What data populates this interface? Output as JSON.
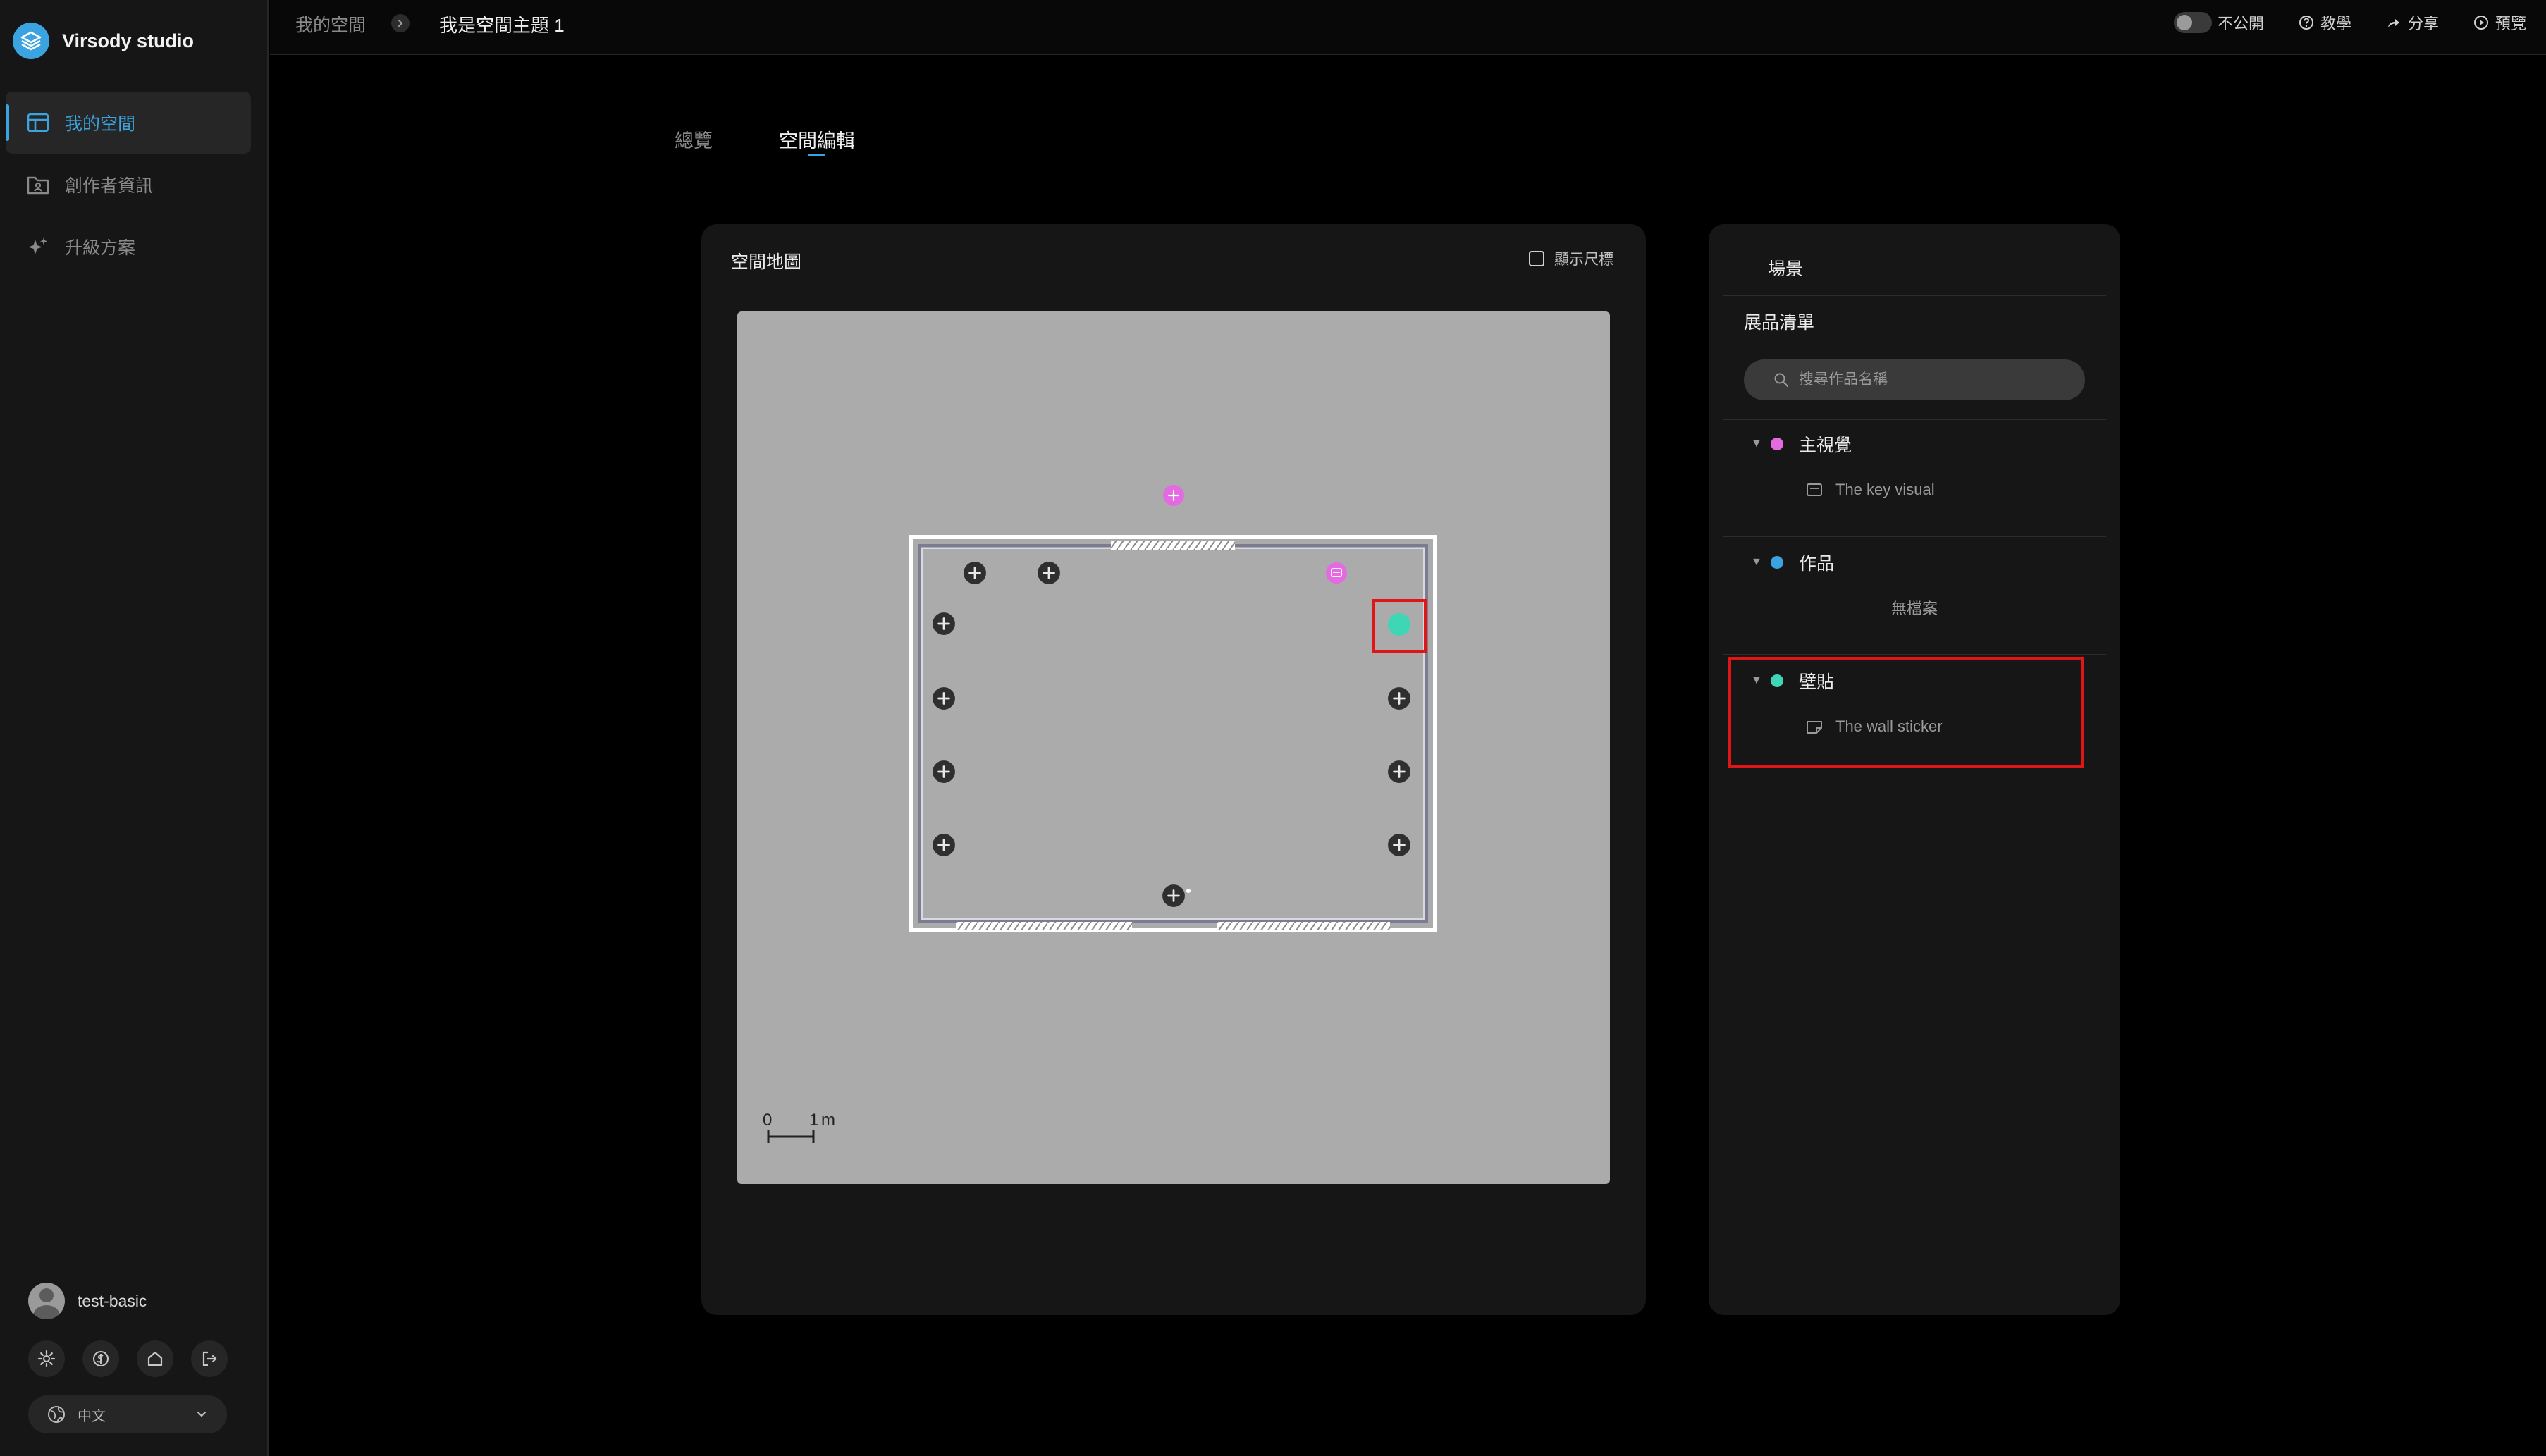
{
  "app": {
    "name": "Virsody studio"
  },
  "sidebar": {
    "items": [
      {
        "label": "我的空間",
        "icon": "layout-icon",
        "active": true
      },
      {
        "label": "創作者資訊",
        "icon": "folder-user-icon",
        "active": false
      },
      {
        "label": "升級方案",
        "icon": "sparkle-icon",
        "active": false
      }
    ],
    "user": {
      "name": "test-basic"
    },
    "tools": [
      "settings-icon",
      "dollar-icon",
      "home-icon",
      "logout-icon"
    ],
    "language": {
      "selected": "中文"
    }
  },
  "breadcrumb": {
    "root": "我的空間",
    "current": "我是空間主題 1"
  },
  "topbar": {
    "visibility_label": "不公開",
    "tutorial_label": "教學",
    "share_label": "分享",
    "preview_label": "預覽"
  },
  "tabs": [
    {
      "label": "總覽",
      "active": false
    },
    {
      "label": "空間編輯",
      "active": true
    }
  ],
  "map_panel": {
    "title": "空間地圖",
    "show_ruler_label": "顯示尺標",
    "show_ruler_checked": false,
    "scale_zero": "0",
    "scale_one": "1",
    "scale_unit": "m"
  },
  "scene_panel": {
    "tab_label": "場景",
    "list_title": "展品清單",
    "search_placeholder": "搜尋作品名稱",
    "groups": [
      {
        "label": "主視覺",
        "color": "#e36ae0",
        "items": [
          "The key visual"
        ],
        "empty_label": ""
      },
      {
        "label": "作品",
        "color": "#3aa3e0",
        "items": [],
        "empty_label": "無檔案"
      },
      {
        "label": "壁貼",
        "color": "#3ed6b5",
        "items": [
          "The wall sticker"
        ],
        "empty_label": ""
      }
    ]
  },
  "colors": {
    "accent": "#3aa3e0",
    "key_visual": "#e36ae0",
    "wall_sticker": "#3ed6b5",
    "highlight": "#e01515"
  }
}
